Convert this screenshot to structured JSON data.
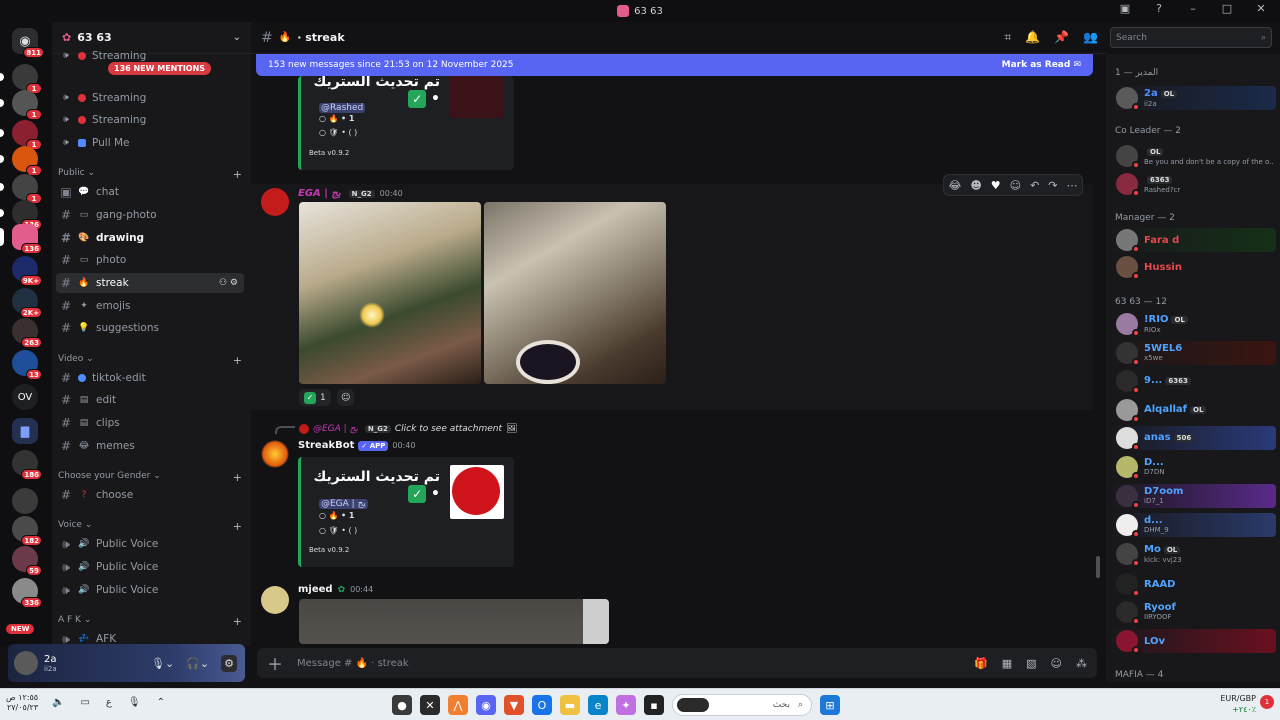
{
  "window": {
    "title": "63 63"
  },
  "server": {
    "name": "63 63",
    "new_mentions": "136 NEW MENTIONS"
  },
  "rail": {
    "badges": [
      "811",
      "1",
      "1",
      "1",
      "1",
      "1",
      "136",
      "9K+",
      "2K+",
      "263",
      "13",
      "186",
      "182",
      "59",
      "336"
    ],
    "ov_label": "OV",
    "new_label": "NEW"
  },
  "channels": {
    "top": [
      {
        "name": "Streaming",
        "kind": "stage"
      },
      {
        "name": "Streaming",
        "kind": "stage"
      },
      {
        "name": "Streaming",
        "kind": "stage"
      },
      {
        "name": "Pull Me",
        "kind": "stage"
      }
    ],
    "categories": [
      {
        "name": "Public",
        "items": [
          "chat",
          "gang-photo",
          "drawing",
          "photo",
          "streak",
          "emojis",
          "suggestions"
        ]
      },
      {
        "name": "Video",
        "items": [
          "tiktok-edit",
          "edit",
          "clips",
          "memes"
        ]
      },
      {
        "name": "Choose your Gender",
        "items": [
          "choose"
        ]
      },
      {
        "name": "Voice",
        "items": [
          "Public Voice",
          "Public Voice",
          "Public Voice"
        ]
      },
      {
        "name": "A F K",
        "items": [
          "AFK"
        ]
      }
    ]
  },
  "user": {
    "name": "2a",
    "sub": "ii2a"
  },
  "channel": {
    "name": "streak",
    "search_placeholder": "Search"
  },
  "banner": {
    "text": "153 new messages since 21:53 on 12 November 2025",
    "action": "Mark as Read"
  },
  "messages": {
    "embed1": {
      "title": "تم تحديث الستريك •",
      "mention": "@Rashed",
      "count": "• 1",
      "shields": "• ( )",
      "footer": "Beta v0.9.2"
    },
    "ega": {
      "author": "EGA | يج",
      "tag": "N_G2",
      "time": "00:40",
      "reaction_count": "1"
    },
    "reply": {
      "author": "@EGA | يج",
      "tag": "N_G2",
      "text": "Click to see attachment"
    },
    "streakbot": {
      "author": "StreakBot",
      "app": "APP",
      "time": "00:40",
      "title": "تم تحديث الستريك •",
      "mention": "@EGA | يج",
      "count": "• 1",
      "shields": "• ( )",
      "footer": "Beta v0.9.2"
    },
    "mjeed": {
      "author": "mjeed",
      "time": "00:44"
    }
  },
  "composer": {
    "placeholder": "Message #",
    "channel": "streak"
  },
  "members": {
    "groups": [
      {
        "header": "المدير — 1",
        "items": [
          {
            "name": "2a",
            "sub": "ii2a",
            "tag": "OL",
            "color": "#4f8cff"
          }
        ]
      },
      {
        "header": "Co Leader — 2",
        "items": [
          {
            "name": "",
            "sub": "Be you and don't be a copy of the o...",
            "tag": "OL",
            "color": "#dbdee1"
          },
          {
            "name": "",
            "sub": "Rashed?cr",
            "tag": "6363",
            "color": "#dbdee1"
          }
        ]
      },
      {
        "header": "Manager — 2",
        "items": [
          {
            "name": "Fara d",
            "sub": "",
            "tag": "",
            "color": "#e5484d"
          },
          {
            "name": "Hussin",
            "sub": "",
            "tag": "",
            "color": "#e5484d"
          }
        ]
      },
      {
        "header": "63 63 — 12",
        "items": [
          {
            "name": "!RIO",
            "sub": "RIOx",
            "tag": "OL",
            "color": "#4fa3ff"
          },
          {
            "name": "5WEL6",
            "sub": "x5we",
            "tag": "",
            "color": "#4fa3ff"
          },
          {
            "name": "9...",
            "sub": "",
            "tag": "6363",
            "color": "#4fa3ff"
          },
          {
            "name": "Alqallaf",
            "sub": "",
            "tag": "OL",
            "color": "#4fa3ff"
          },
          {
            "name": "anas",
            "sub": "",
            "tag": "506",
            "color": "#4fa3ff"
          },
          {
            "name": "D...",
            "sub": "D7DN",
            "tag": "",
            "color": "#4fa3ff"
          },
          {
            "name": "D7oom",
            "sub": "iD7_1",
            "tag": "",
            "color": "#4fa3ff"
          },
          {
            "name": "d...",
            "sub": "DHM_9",
            "tag": "",
            "color": "#4fa3ff"
          },
          {
            "name": "Mo",
            "sub": "kick: vvj23",
            "tag": "OL",
            "color": "#4fa3ff"
          },
          {
            "name": "RAAD",
            "sub": "",
            "tag": "",
            "color": "#4fa3ff"
          },
          {
            "name": "Ryoof",
            "sub": "IIRYOOF",
            "tag": "",
            "color": "#4fa3ff"
          },
          {
            "name": "LOv",
            "sub": "",
            "tag": "",
            "color": "#4fa3ff"
          }
        ]
      },
      {
        "header": "MAFIA — 4",
        "items": []
      }
    ]
  },
  "taskbar": {
    "time_left": "١٢:٥٥ ص",
    "date_left": "٢٧/٠٥/٢٣",
    "lang": "ع",
    "search_text": "بحث",
    "currency": "EUR/GBP",
    "currency_change": "+٢٤٠٪",
    "notif": "1"
  },
  "colors": {
    "accent": "#5865f2",
    "green": "#23a55a",
    "red": "#e0303a"
  }
}
